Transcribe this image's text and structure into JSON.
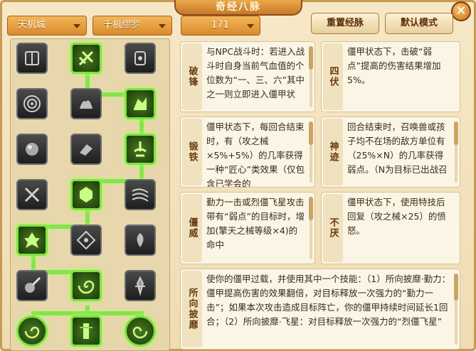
{
  "window": {
    "title": "奇经八脉",
    "close": "✕"
  },
  "filters": {
    "sect": "天机城",
    "school": "千机缪罗",
    "level": "171"
  },
  "buttons": {
    "reset": "重置经脉",
    "default": "默认模式"
  },
  "skills": [
    {
      "name": "book-skill-icon",
      "active": false
    },
    {
      "name": "blade-burst-skill-icon",
      "active": true
    },
    {
      "name": "rune-skill-icon",
      "active": false
    },
    {
      "name": "ring-skill-icon",
      "active": false
    },
    {
      "name": "beast-skill-icon",
      "active": false
    },
    {
      "name": "stone-skill-icon",
      "active": true
    },
    {
      "name": "orb-skill-icon",
      "active": false
    },
    {
      "name": "block-skill-icon",
      "active": false
    },
    {
      "name": "fountain-skill-icon",
      "active": true
    },
    {
      "name": "cross-blade-skill-icon",
      "active": false
    },
    {
      "name": "gear-skill-icon",
      "active": true
    },
    {
      "name": "wind-skill-icon",
      "active": false
    },
    {
      "name": "demon-skill-icon",
      "active": true
    },
    {
      "name": "diamond-skill-icon",
      "active": false
    },
    {
      "name": "spirit-skill-icon",
      "active": false
    },
    {
      "name": "meteor-skill-icon",
      "active": false
    },
    {
      "name": "vortex-skill-icon",
      "active": true
    },
    {
      "name": "warrior-skill-icon",
      "active": false
    },
    {
      "name": "swirl-left-skill-icon",
      "active": true
    },
    {
      "name": "pillar-skill-icon",
      "active": true
    },
    {
      "name": "swirl-right-skill-icon",
      "active": true
    }
  ],
  "cards": [
    {
      "label": "破锋",
      "text": "与NPC战斗时：若进入战斗时自身当前气血值的个位数为“一、三、六”其中之一则立即进入僵甲状"
    },
    {
      "label": "四伏",
      "text": "僵甲状态下，击破“弱点”提高的伤害结果增加5%。"
    },
    {
      "label": "锻铁",
      "text": "僵甲状态下，每回合结束时，有（攻之械×5%+5%）的几率获得一种“匠心”类效果（仅包含已学会的"
    },
    {
      "label": "神迹",
      "text": "回合结束时，召唤兽或孩子均不在场的敌方单位有（25%×N）的几率获得弱点。（N为目标已出战召"
    },
    {
      "label": "僵威",
      "text": "勤力一击或烈僵飞星攻击带有“弱点”的目标时，增加(擎天之械等级×4)的命中"
    },
    {
      "label": "不厌",
      "text": "僵甲状态下，使用特技后回复（攻之械×25）的愤怒。"
    },
    {
      "label": "所向披靡",
      "text": "使你的僵甲过载，并使用其中一个技能：（1）所向披靡·勤力：僵甲提高伤害的效果翻倍，对目标释放一次强力的“勤力一击”；如果本次攻击造成目标阵亡，你的僵甲持续时间延长1回合；（2）所向披靡·飞星：对目标释放一次强力的“烈僵飞星”"
    }
  ]
}
